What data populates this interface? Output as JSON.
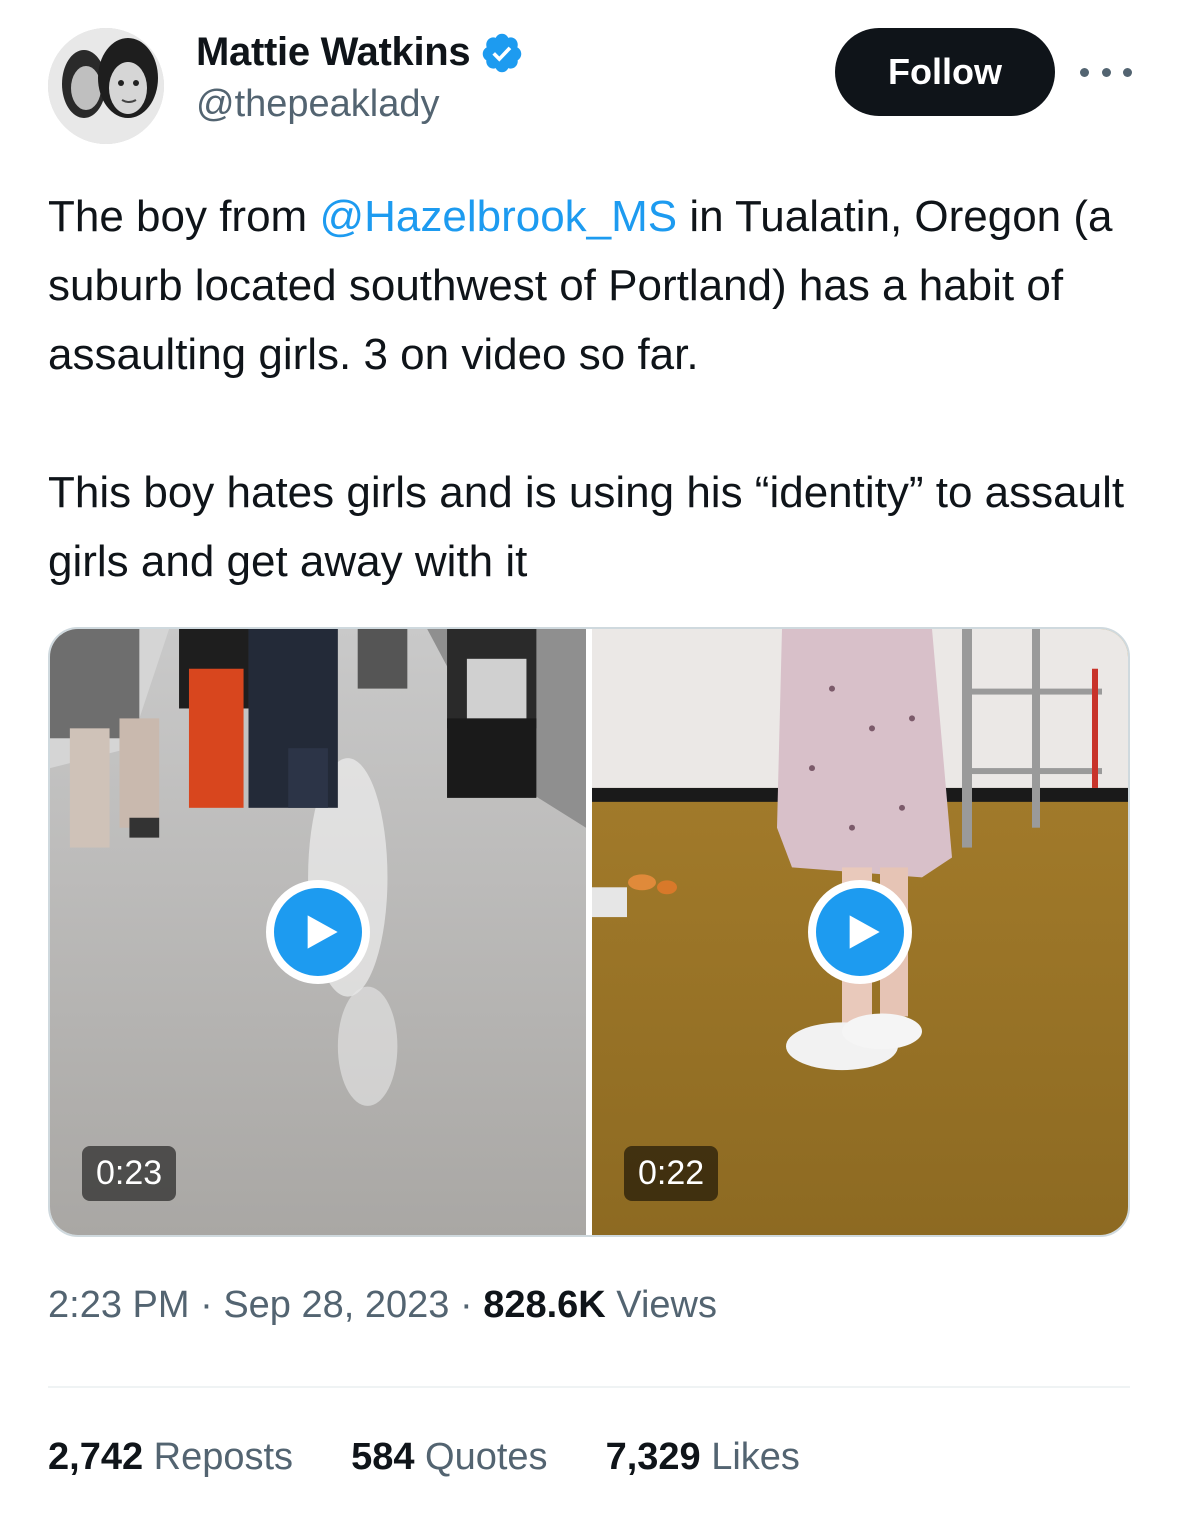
{
  "author": {
    "display_name": "Mattie Watkins",
    "handle": "@thepeaklady",
    "verified": true,
    "verified_color": "#1d9bf0"
  },
  "header": {
    "follow_label": "Follow",
    "more_icon": "ellipsis-icon"
  },
  "tweet": {
    "paragraph1": {
      "before": "The boy from ",
      "mention": "@Hazelbrook_MS",
      "after": " in Tualatin, Oregon (a suburb located southwest of Portland) has a habit of assaulting girls. 3 on video so far."
    },
    "paragraph2": "This boy hates girls and is using his “identity” to assault girls and get away with it"
  },
  "media": [
    {
      "type": "video",
      "duration": "0:23",
      "play_icon": "play-icon"
    },
    {
      "type": "video",
      "duration": "0:22",
      "play_icon": "play-icon"
    }
  ],
  "meta": {
    "time": "2:23 PM",
    "separator": "·",
    "date": "Sep 28, 2023",
    "views_count": "828.6K",
    "views_label": "Views"
  },
  "stats": {
    "reposts_count": "2,742",
    "reposts_label": "Reposts",
    "quotes_count": "584",
    "quotes_label": "Quotes",
    "likes_count": "7,329",
    "likes_label": "Likes"
  },
  "colors": {
    "accent": "#1d9bf0",
    "text": "#0f1419",
    "secondary": "#536471"
  }
}
